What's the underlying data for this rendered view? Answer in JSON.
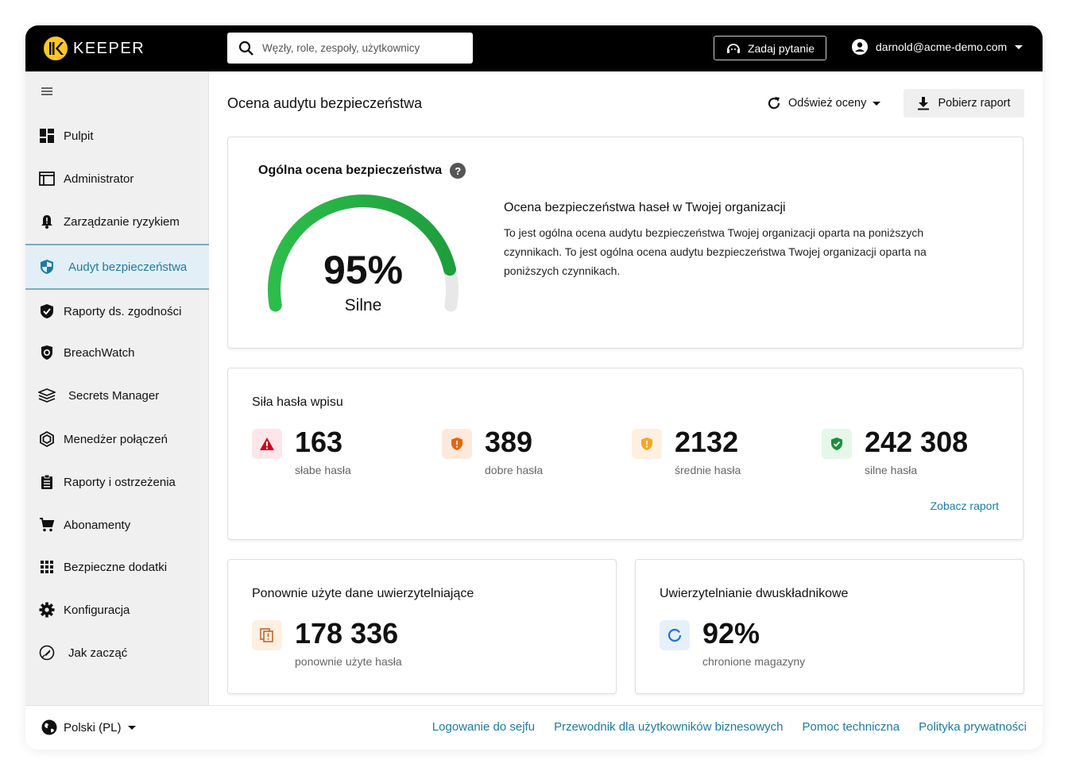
{
  "app": {
    "brand": "KEEPER",
    "search_placeholder": "Węzły, role, zespoły, użytkownicy",
    "ask_button": "Zadaj pytanie",
    "user_email": "darnold@acme-demo.com"
  },
  "sidebar": {
    "items": [
      {
        "label": "Pulpit",
        "icon": "dashboard-icon"
      },
      {
        "label": "Administrator",
        "icon": "admin-window-icon"
      },
      {
        "label": "Zarządzanie ryzykiem",
        "icon": "bell-alert-icon"
      },
      {
        "label": "Audyt bezpieczeństwa",
        "icon": "shield-half-icon",
        "active": true
      },
      {
        "label": "Raporty ds. zgodności",
        "icon": "shield-check-icon"
      },
      {
        "label": "BreachWatch",
        "icon": "breachwatch-icon"
      },
      {
        "label": "Secrets Manager",
        "icon": "layers-icon"
      },
      {
        "label": "Menedżer połączeń",
        "icon": "connection-hexagon-icon"
      },
      {
        "label": "Raporty i ostrzeżenia",
        "icon": "clipboard-icon"
      },
      {
        "label": "Abonamenty",
        "icon": "cart-icon"
      },
      {
        "label": "Bezpieczne dodatki",
        "icon": "grid-icon"
      },
      {
        "label": "Konfiguracja",
        "icon": "gear-icon"
      },
      {
        "label": "Jak zacząć",
        "icon": "rocket-icon"
      }
    ]
  },
  "footer": {
    "language": "Polski (PL)",
    "links": [
      "Logowanie do sejfu",
      "Przewodnik dla użytkowników biznesowych",
      "Pomoc techniczna",
      "Polityka prywatności"
    ]
  },
  "main": {
    "title": "Ocena audytu bezpieczeństwa",
    "refresh_label": "Odśwież oceny",
    "download_label": "Pobierz raport",
    "overall": {
      "title": "Ogólna ocena bezpieczeństwa",
      "score_percent": 95,
      "score_text": "95%",
      "rating": "Silne",
      "desc_title": "Ocena bezpieczeństwa haseł w Twojej organizacji",
      "desc_body": "To jest ogólna ocena audytu bezpieczeństwa Twojej organizacji oparta na poniższych czynnikach. To jest ogólna ocena audytu bezpieczeństwa Twojej organizacji oparta na poniższych czynnikach."
    },
    "strength": {
      "title": "Siła hasła wpisu",
      "stats": [
        {
          "value": "163",
          "label": "słabe hasła",
          "icon": "warning-triangle-icon",
          "color": "#d0021b",
          "bg": "#fde6ea"
        },
        {
          "value": "389",
          "label": "dobre hasła",
          "icon": "shield-exclamation-icon",
          "color": "#e8650a",
          "bg": "#fde9dc"
        },
        {
          "value": "2132",
          "label": "średnie hasła",
          "icon": "shield-exclamation-icon",
          "color": "#f5a623",
          "bg": "#fdf0e0"
        },
        {
          "value": "242 308",
          "label": "silne hasła",
          "icon": "shield-check-icon",
          "color": "#1e8e3e",
          "bg": "#e5f7e9"
        }
      ],
      "view_report": "Zobacz raport"
    },
    "reused": {
      "title": "Ponownie użyte dane uwierzytelniające",
      "value": "178 336",
      "label": "ponownie użyte hasła"
    },
    "twofa": {
      "title": "Uwierzytelnianie dwuskładnikowe",
      "value": "92%",
      "label": "chronione magazyny"
    }
  },
  "colors": {
    "accent": "#1a7ba6",
    "gauge_green": "#22b14c",
    "gauge_track": "#e8e8e8",
    "brand_yellow": "#ffc629"
  }
}
